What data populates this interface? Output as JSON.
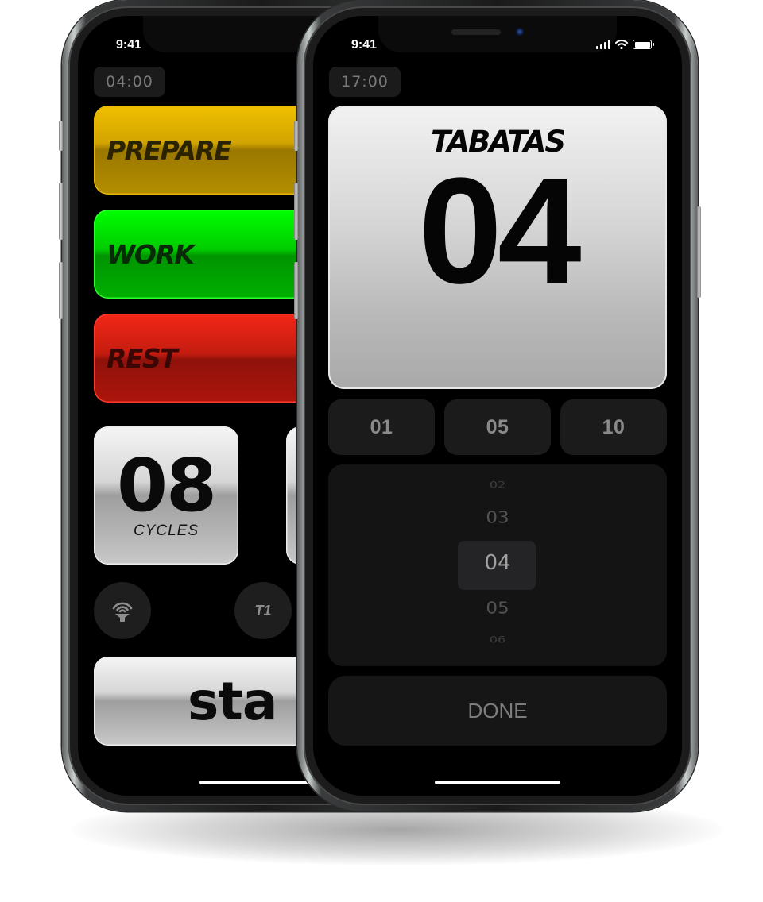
{
  "left_phone": {
    "status_time": "9:41",
    "timer": "04:00",
    "phases": [
      {
        "label": "PREPARE",
        "color": "#e0b000"
      },
      {
        "label": "WORK",
        "color": "#00d400"
      },
      {
        "label": "REST",
        "color": "#d01c10"
      }
    ],
    "cycles": {
      "value": "08",
      "label": "CYCLES"
    },
    "sound_button_icon": "speaker-broadcast-icon",
    "t1_button": "T1",
    "start_button": "sta"
  },
  "right_phone": {
    "status_time": "9:41",
    "timer": "17:00",
    "tabatas": {
      "title": "TABATAS",
      "value": "04"
    },
    "presets": [
      "01",
      "05",
      "10"
    ],
    "picker": {
      "items": [
        "02",
        "03",
        "04",
        "05",
        "06"
      ],
      "selected": "04"
    },
    "done_button": "DONE"
  }
}
